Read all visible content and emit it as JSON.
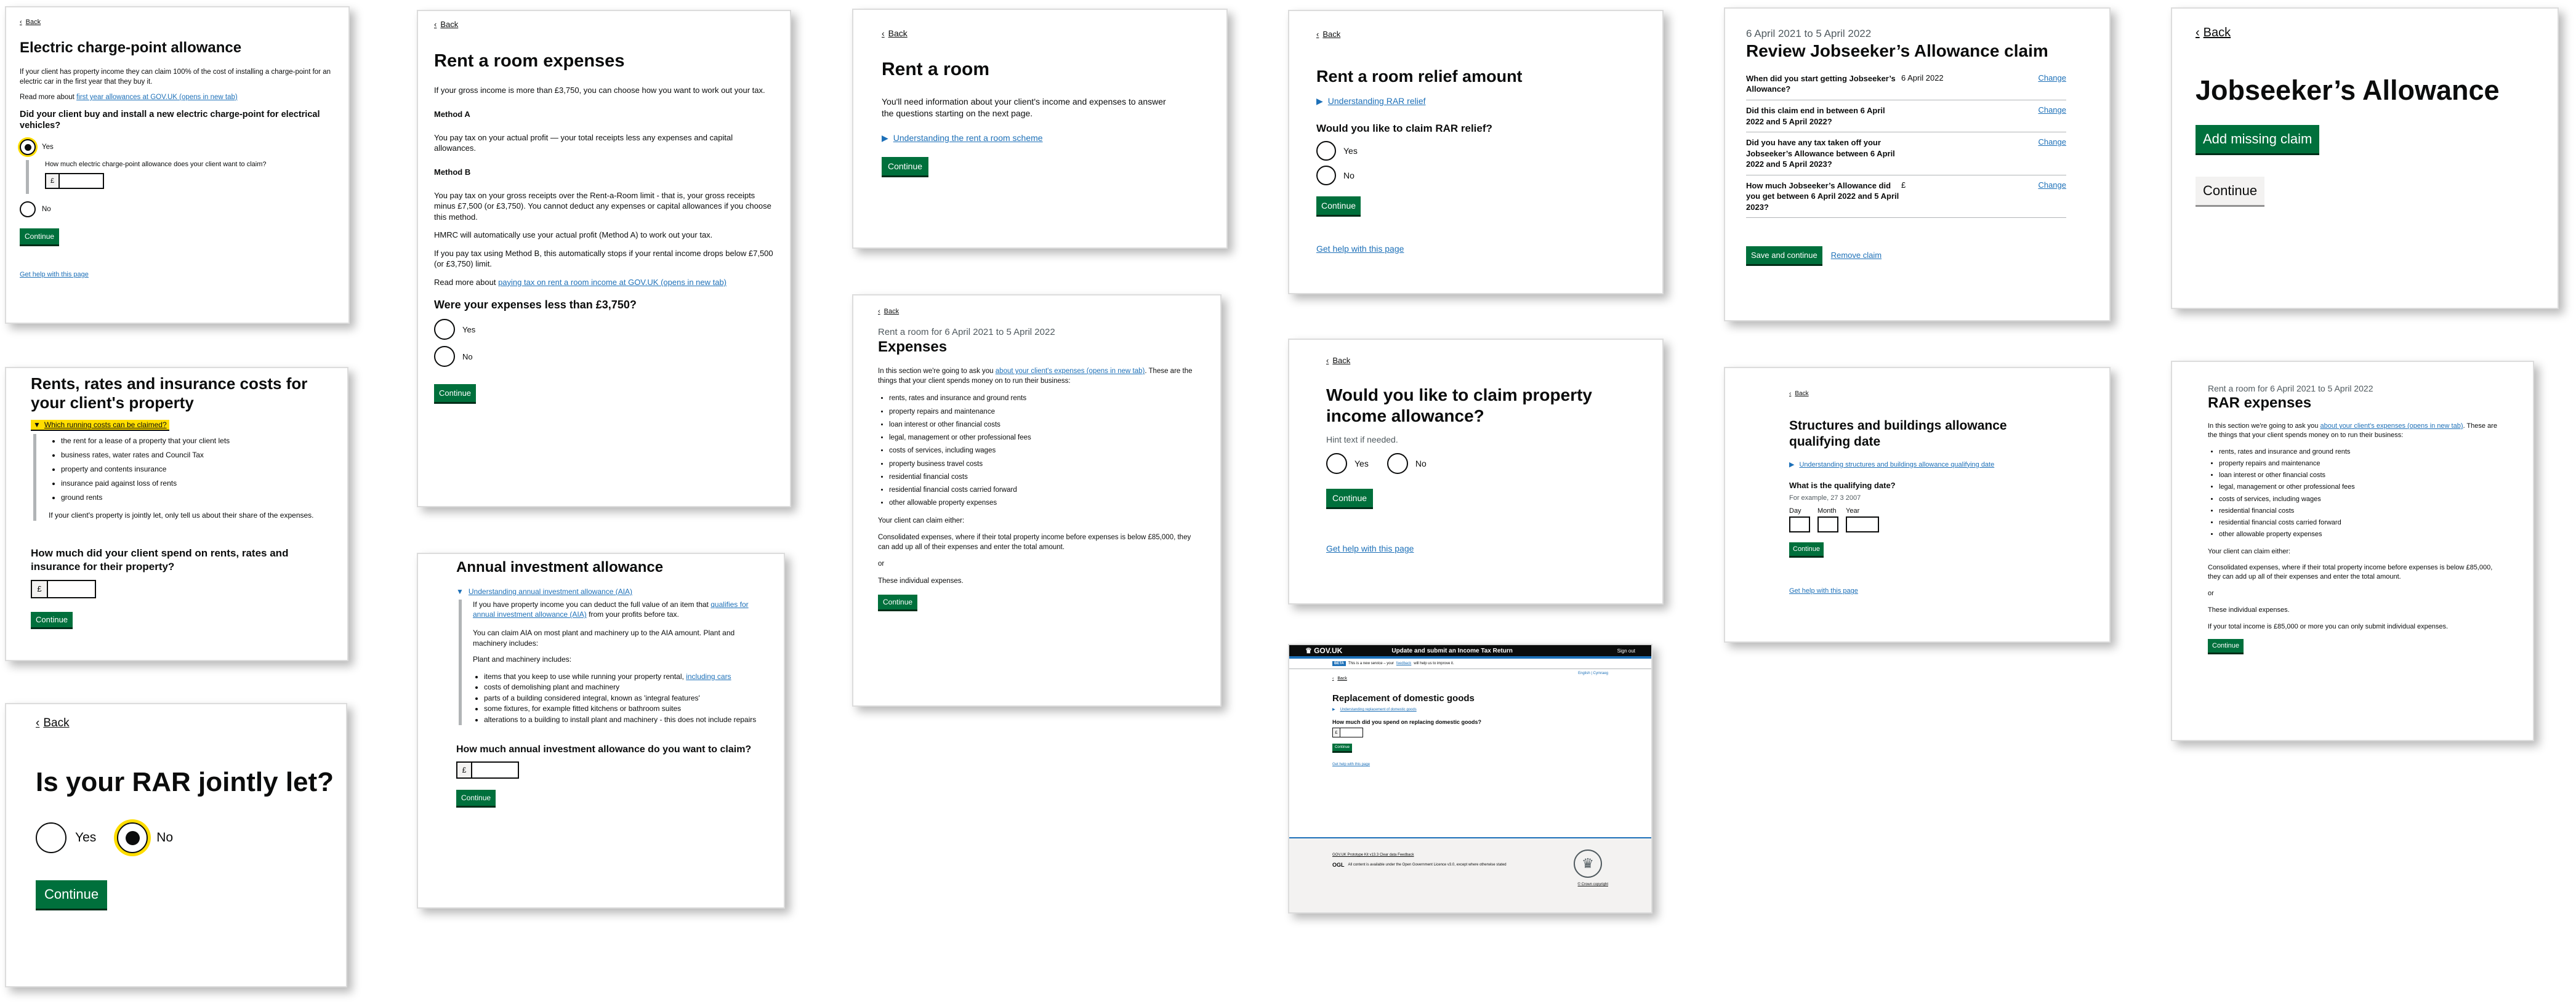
{
  "common": {
    "back": "Back",
    "continue": "Continue",
    "yes": "Yes",
    "no": "No",
    "help": "Get help with this page",
    "pound": "£",
    "change": "Change"
  },
  "c1": {
    "title": "Electric charge-point allowance",
    "p1": "If your client has property income they can claim 100% of the cost of installing a charge-point for an electric car in the first year that they buy it.",
    "readmore_text": "Read more about",
    "readmore_link": "first year allowances at GOV.UK (opens in new tab)",
    "question": "Did your client buy and install a new electric charge-point for electrical vehicles?",
    "conditional_label": "How much electric charge-point allowance does your client want to claim?"
  },
  "c2": {
    "title": "Rent a room expenses",
    "p1": "If your gross income is more than £3,750, you can choose how you want to work out your tax.",
    "methodA": "Method A",
    "pA": "You pay tax on your actual profit — your total receipts less any expenses and capital allowances.",
    "methodB": "Method B",
    "pB": "You pay tax on your gross receipts over the Rent-a-Room limit - that is, your gross receipts minus £7,500 (or £3,750). You cannot deduct any expenses or capital allowances if you choose this method.",
    "p3": "HMRC will automatically use your actual profit (Method A) to work out your tax.",
    "p4": "If you pay tax using Method B, this automatically stops if your rental income drops below £7,500 (or £3,750) limit.",
    "readmore_text": "Read more about",
    "readmore_link": "paying tax on rent a room income at GOV.UK (opens in new tab)",
    "question": "Were your expenses less than £3,750?"
  },
  "c3": {
    "title": "Rent a room",
    "p1": "You'll need information about your client's income and expenses to answer the questions starting on the next page.",
    "details": "Understanding the rent a room scheme"
  },
  "c4": {
    "title": "Rent a room relief amount",
    "details": "Understanding RAR relief",
    "question": "Would you like to claim RAR relief?"
  },
  "c5": {
    "caption": "6 April 2021 to 5 April 2022",
    "title": "Review Jobseeker’s Allowance claim",
    "rows": [
      {
        "q": "When did you start getting Jobseeker’s Allowance?",
        "a": "6 April 2022"
      },
      {
        "q": "Did this claim end in between 6 April 2022 and 5 April 2022?",
        "a": ""
      },
      {
        "q": "Did you have any tax taken off your Jobseeker’s Allowance between 6 April 2022 and 5 April 2023?",
        "a": ""
      },
      {
        "q": "How much Jobseeker’s Allowance did you get between 6 April 2022 and 5 April 2023?",
        "a": "£"
      }
    ],
    "save": "Save and continue",
    "remove": "Remove claim"
  },
  "c6": {
    "title": "Jobseeker’s Allowance",
    "add": "Add missing claim"
  },
  "c7": {
    "title": "Rents, rates and insurance costs for your client's property",
    "details": "Which running costs can be claimed?",
    "items": [
      "the rent for a lease of a property that your client lets",
      "business rates, water rates and Council Tax",
      "property and contents insurance",
      "insurance paid against loss of rents",
      "ground rents"
    ],
    "p1": "If your client's property is jointly let, only tell us about their share of the expenses.",
    "question": "How much did your client spend on rents, rates and insurance for their property?"
  },
  "c8": {
    "caption": "Rent a room for 6 April 2021 to 5 April 2022",
    "title": "Expenses",
    "intro_a": "In this section we're going to ask you",
    "intro_link": "about your client's expenses (opens in new tab)",
    "intro_b": ". These are the things that your client spends money on to run their business:",
    "items": [
      "rents, rates and insurance and ground rents",
      "property repairs and maintenance",
      "loan interest or other financial costs",
      "legal, management or other professional fees",
      "costs of services, including wages",
      "property business travel costs",
      "residential financial costs",
      "residential financial costs carried forward",
      "other allowable property expenses"
    ],
    "p_either": "Your client can claim either:",
    "p_consolidated": "Consolidated expenses, where if their total property income before expenses is below £85,000, they can add up all of their expenses and enter the total amount.",
    "or": "or",
    "p_individual": "These individual expenses."
  },
  "c9": {
    "title": "Would you like to claim property income allowance?",
    "hint": "Hint text if needed."
  },
  "c10": {
    "title": "Structures and buildings allowance qualifying date",
    "details": "Understanding structures and buildings allowance qualifying date",
    "question": "What is the qualifying date?",
    "hint": "For example, 27 3 2007",
    "day": "Day",
    "month": "Month",
    "year": "Year"
  },
  "c11": {
    "caption": "Rent a room for 6 April 2021 to 5 April 2022",
    "title": "RAR expenses",
    "intro_a": "In this section we're going to ask you",
    "intro_link": "about your client's expenses (opens in new tab)",
    "intro_b": ". These are the things that your client spends money on to run their business:",
    "items": [
      "rents, rates and insurance and ground rents",
      "property repairs and maintenance",
      "loan interest or other financial costs",
      "legal, management or other professional fees",
      "costs of services, including wages",
      "residential financial costs",
      "residential financial costs carried forward",
      "other allowable property expenses"
    ],
    "p_either": "Your client can claim either:",
    "p_consolidated": "Consolidated expenses, where if their total property income before expenses is below £85,000, they can add up all of their expenses and enter the total amount.",
    "or": "or",
    "p_individual": "These individual expenses.",
    "p_over": "If your total income is £85,000 or more you can only submit individual expenses."
  },
  "c12": {
    "title": "Is your RAR jointly let?"
  },
  "c13": {
    "title": "Annual investment allowance",
    "details": "Understanding annual investment allowance (AIA)",
    "p1a": "If you have property income you can deduct the full value of an item that",
    "p1link": "qualifies for annual investment allowance (AIA)",
    "p1b": "from your profits before tax.",
    "p2": "You can claim AIA on most plant and machinery up to the AIA amount. Plant and machinery includes:",
    "p3": "Plant and machinery includes:",
    "item1a": "items that you keep to use while running your property rental,",
    "item1link": "including cars",
    "items": [
      "costs of demolishing plant and machinery",
      "parts of a building considered integral, known as 'integral features'",
      "some fixtures, for example fitted kitchens or bathroom suites",
      "alterations to a building to install plant and machinery - this does not include repairs"
    ],
    "question": "How much annual investment allowance do you want to claim?"
  },
  "c14": {
    "logo": "GOV.UK",
    "service": "Update and submit an Income Tax Return",
    "signout": "Sign out",
    "beta": "BETA",
    "banner_a": "This is a new service – your",
    "banner_link": "feedback",
    "banner_b": "will help us to improve it.",
    "lang": "English | Cymraeg",
    "title": "Replacement of domestic goods",
    "details": "Understanding replacement of domestic goods",
    "question": "How much did you spend on replacing domestic goods?",
    "footer_links": "GOV.UK Prototype Kit v13.3  Clear data  Feedback",
    "ogl": "OGL",
    "licence": "All content is available under the Open Government Licence v3.0, except where otherwise stated",
    "crown": "© Crown copyright"
  }
}
